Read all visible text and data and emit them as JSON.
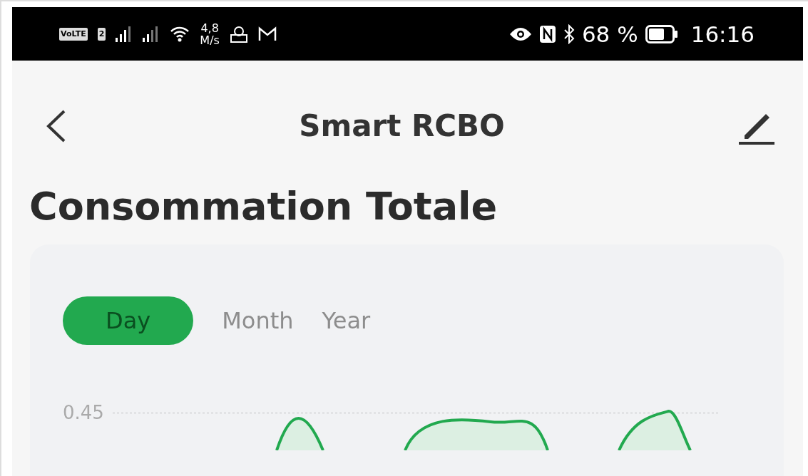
{
  "status_bar": {
    "volte": "VoLTE",
    "sim": "2",
    "speed_value": "4,8",
    "speed_unit": "M/s",
    "battery": "68 %",
    "time": "16:16"
  },
  "header": {
    "title": "Smart RCBO"
  },
  "section_title": "Consommation Totale",
  "tabs": [
    {
      "label": "Day",
      "selected": true
    },
    {
      "label": "Month",
      "selected": false
    },
    {
      "label": "Year",
      "selected": false
    }
  ],
  "chart": {
    "y_tick": "0.45"
  }
}
